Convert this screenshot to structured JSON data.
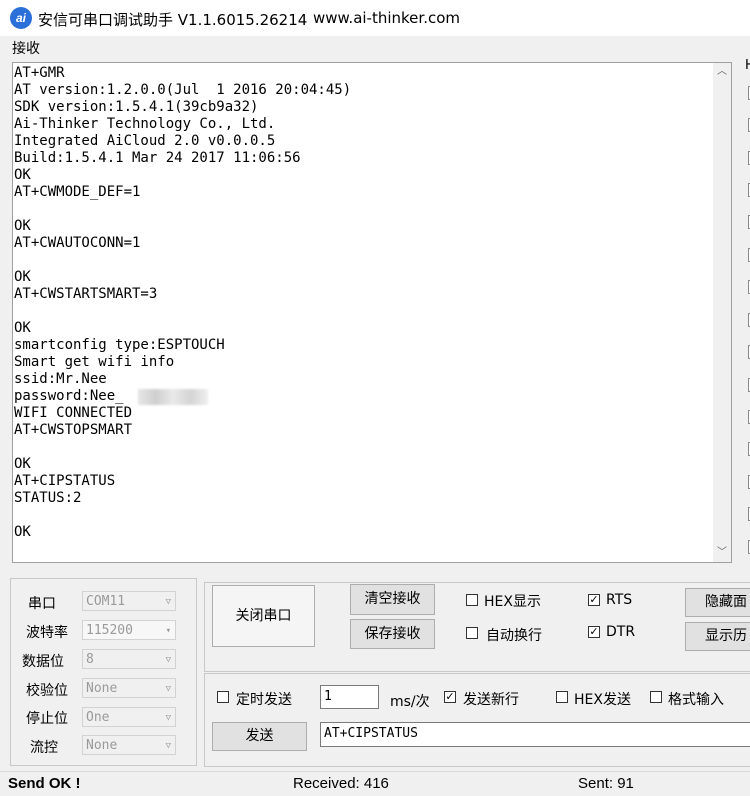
{
  "window": {
    "icon_text": "ai",
    "title": "安信可串口调试助手 V1.1.6015.26214",
    "url": "www.ai-thinker.com"
  },
  "receive": {
    "group_label": "接收",
    "lines": [
      "AT+GMR",
      "AT version:1.2.0.0(Jul  1 2016 20:04:45)",
      "SDK version:1.5.4.1(39cb9a32)",
      "Ai-Thinker Technology Co., Ltd.",
      "Integrated AiCloud 2.0 v0.0.0.5",
      "Build:1.5.4.1 Mar 24 2017 11:06:56",
      "OK",
      "AT+CWMODE_DEF=1",
      "",
      "OK",
      "AT+CWAUTOCONN=1",
      "",
      "OK",
      "AT+CWSTARTSMART=3",
      "",
      "OK",
      "smartconfig type:ESPTOUCH",
      "Smart get wifi info",
      "ssid:Mr.Nee",
      "password:Nee_",
      "WIFI CONNECTED",
      "AT+CWSTOPSMART",
      "",
      "OK",
      "AT+CIPSTATUS",
      "STATUS:2",
      "",
      "OK"
    ],
    "scroll_up": "︿",
    "scroll_down": "﹀"
  },
  "serial_settings": {
    "port_label": "串口",
    "port_value": "COM11",
    "baud_label": "波特率",
    "baud_value": "115200",
    "databits_label": "数据位",
    "databits_value": "8",
    "parity_label": "校验位",
    "parity_value": "None",
    "stopbits_label": "停止位",
    "stopbits_value": "One",
    "flow_label": "流控",
    "flow_value": "None"
  },
  "buttons": {
    "close_port": "关闭串口",
    "clear_receive": "清空接收",
    "save_receive": "保存接收",
    "hide_panel": "隐藏面",
    "show_history": "显示历",
    "send": "发送"
  },
  "options": {
    "hex_display": {
      "label": "HEX显示",
      "checked": false
    },
    "auto_newline": {
      "label": "自动换行",
      "checked": false
    },
    "rts": {
      "label": "RTS",
      "checked": true
    },
    "dtr": {
      "label": "DTR",
      "checked": true
    },
    "timed_send": {
      "label": "定时发送",
      "checked": false
    },
    "send_newline": {
      "label": "发送新行",
      "checked": true
    },
    "hex_send": {
      "label": "HEX发送",
      "checked": false
    },
    "format_input": {
      "label": "格式输入",
      "checked": false
    }
  },
  "send": {
    "interval_value": "1",
    "interval_unit": "ms/次",
    "input_value": "AT+CIPSTATUS"
  },
  "status": {
    "send_status": "Send OK !",
    "received": "Received: 416",
    "sent": "Sent: 91"
  },
  "colors": {
    "app_icon": "#2b6fd8",
    "window_bg": "#f0f0f0",
    "text_bg": "#ffffff"
  }
}
